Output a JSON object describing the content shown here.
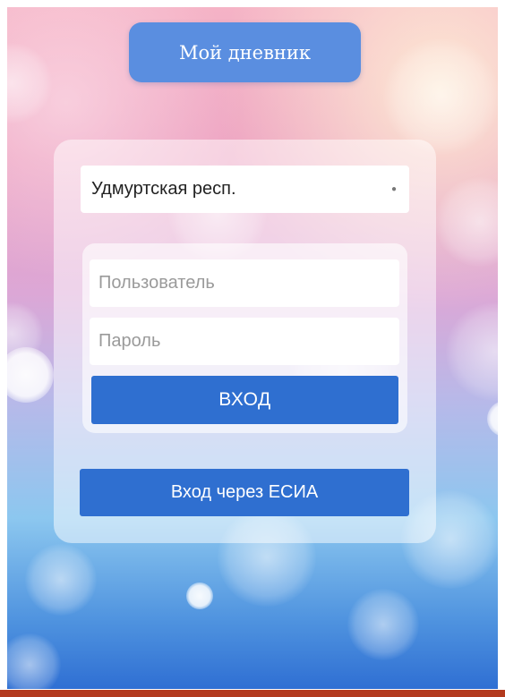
{
  "app": {
    "title": "Мой дневник"
  },
  "login": {
    "region_select": {
      "value": "Удмуртская респ."
    },
    "username_field": {
      "value": "",
      "placeholder": "Пользователь"
    },
    "password_field": {
      "value": "",
      "placeholder": "Пароль"
    },
    "submit_label": "ВХОД",
    "esia_label": "Вход через ЕСИА"
  },
  "colors": {
    "button": "#2f6fd0",
    "title_pill": "#5a8ee0",
    "bottom_bar": "#b33a1e"
  },
  "icons": {
    "select_arrow": "dropdown-arrow-icon"
  }
}
